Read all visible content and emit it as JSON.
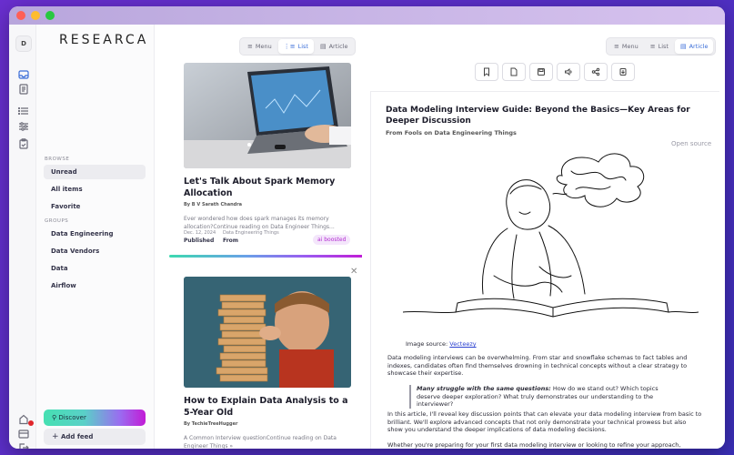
{
  "app": {
    "logo": "RESEARCA",
    "avatar_initial": "D",
    "colors": {
      "accent": "#3b6ed8",
      "badge": "#b22bd0",
      "notification": "#e0252a"
    }
  },
  "rail": {
    "icons": [
      "inbox-icon",
      "document-icon",
      "list-icon",
      "sliders-icon",
      "clipboard-icon",
      "settings-icon",
      "layout-icon",
      "logout-icon"
    ]
  },
  "sidebar": {
    "browse_label": "BROWSE",
    "browse_items": [
      "Unread",
      "All items",
      "Favorite"
    ],
    "groups_label": "GROUPS",
    "group_items": [
      "Data Engineering",
      "Data Vendors",
      "Data",
      "Airflow"
    ],
    "discover_label": "Discover",
    "add_feed_label": "Add feed"
  },
  "view_switch": {
    "menu": "Menu",
    "list": "List",
    "article": "Article"
  },
  "list": {
    "items": [
      {
        "title": "Let's Talk About Spark Memory Allocation",
        "author": "By B V Sarath Chandra",
        "description": "Ever wondered how does spark manages its memory allocation?Continue reading on Data Engineer Things...",
        "date": "Dec. 12, 2024",
        "status": "Published",
        "feed": "Data Engineering Things",
        "from": "From",
        "badge": "ai boosted"
      },
      {
        "title": "How to Explain Data Analysis to a 5-Year Old",
        "author": "By TechieTreeHugger",
        "description": "A Common Interview questionContinue reading on Data Engineer Things »"
      }
    ]
  },
  "article": {
    "title": "Data Modeling Interview Guide: Beyond the Basics—Key Areas for Deeper Discussion",
    "source": "From Fools on Data Engineering Things",
    "open_source": "Open source",
    "image_source_label": "Image source:",
    "image_source_link": "Vecteezy",
    "para1": "Data modeling interviews can be overwhelming. From star and snowflake schemas to fact tables and indexes, candidates often find themselves drowning in technical concepts without a clear strategy to showcase their expertise.",
    "quote_bold": "Many struggle with the same questions:",
    "quote_rest": " How do we stand out? Which topics deserve deeper exploration? What truly demonstrates our understanding to the interviewer?",
    "para2": "In this article, I'll reveal key discussion points that can elevate your data modeling interview from basic to brilliant. We'll explore advanced concepts that not only demonstrate your technical prowess but also show you understand the deeper implications of data modeling decisions.",
    "para3": "Whether you're preparing for your first data modeling interview or looking to refine your approach,"
  },
  "toolbar": {
    "icons": [
      "bookmark-icon",
      "file-icon",
      "save-icon",
      "speaker-icon",
      "share-icon",
      "download-icon"
    ]
  }
}
